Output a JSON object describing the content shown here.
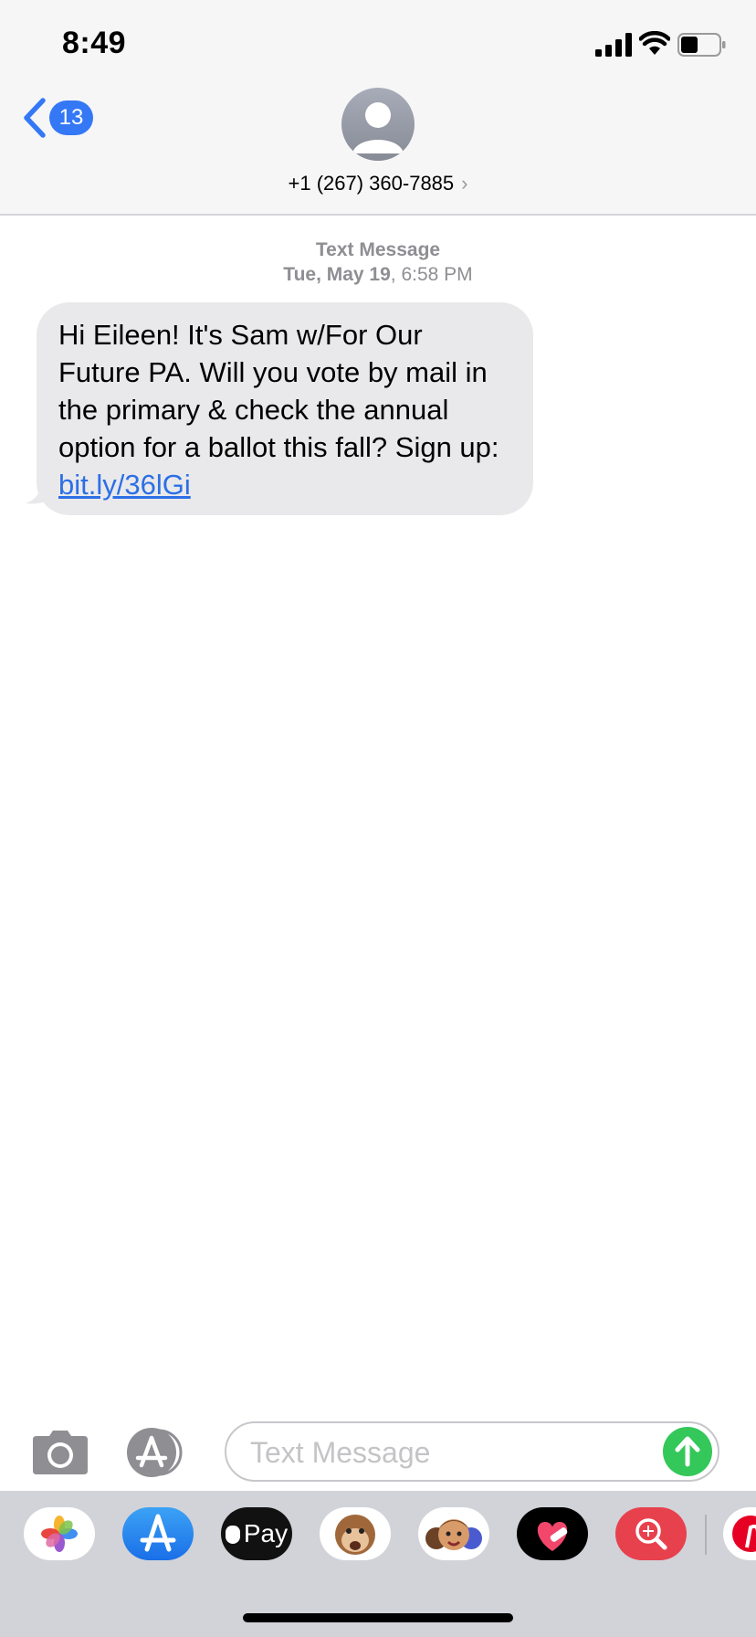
{
  "status_bar": {
    "time": "8:49",
    "icons": [
      "cellular-signal-icon",
      "wifi-icon",
      "battery-icon"
    ]
  },
  "header": {
    "back_badge": "13",
    "contact": "+1 (267) 360-7885",
    "contact_chevron": "›",
    "avatar_icon": "person-silhouette-icon"
  },
  "conversation": {
    "service_label": "Text Message",
    "date_bold": "Tue, May 19",
    "time_suffix": ", 6:58 PM",
    "message": {
      "text": "Hi Eileen! It's Sam w/For Our Future PA. Will you vote by mail in the primary & check the annual option for a ballot this fall? Sign up: ",
      "link": "bit.ly/36lGi"
    }
  },
  "composer": {
    "placeholder": "Text Message",
    "value": ""
  },
  "app_drawer": {
    "apps": [
      "photos-icon",
      "app-store-icon",
      "apple-pay-icon",
      "animoji-icon",
      "memoji-icon",
      "heart-sticker-icon",
      "image-search-icon",
      "pinterest-icon"
    ],
    "pay_label": "Pay"
  },
  "colors": {
    "accent": "#3478f6",
    "bubble_gray": "#e9e9eb",
    "send_green": "#34c759",
    "link_blue": "#2c6fe5"
  }
}
